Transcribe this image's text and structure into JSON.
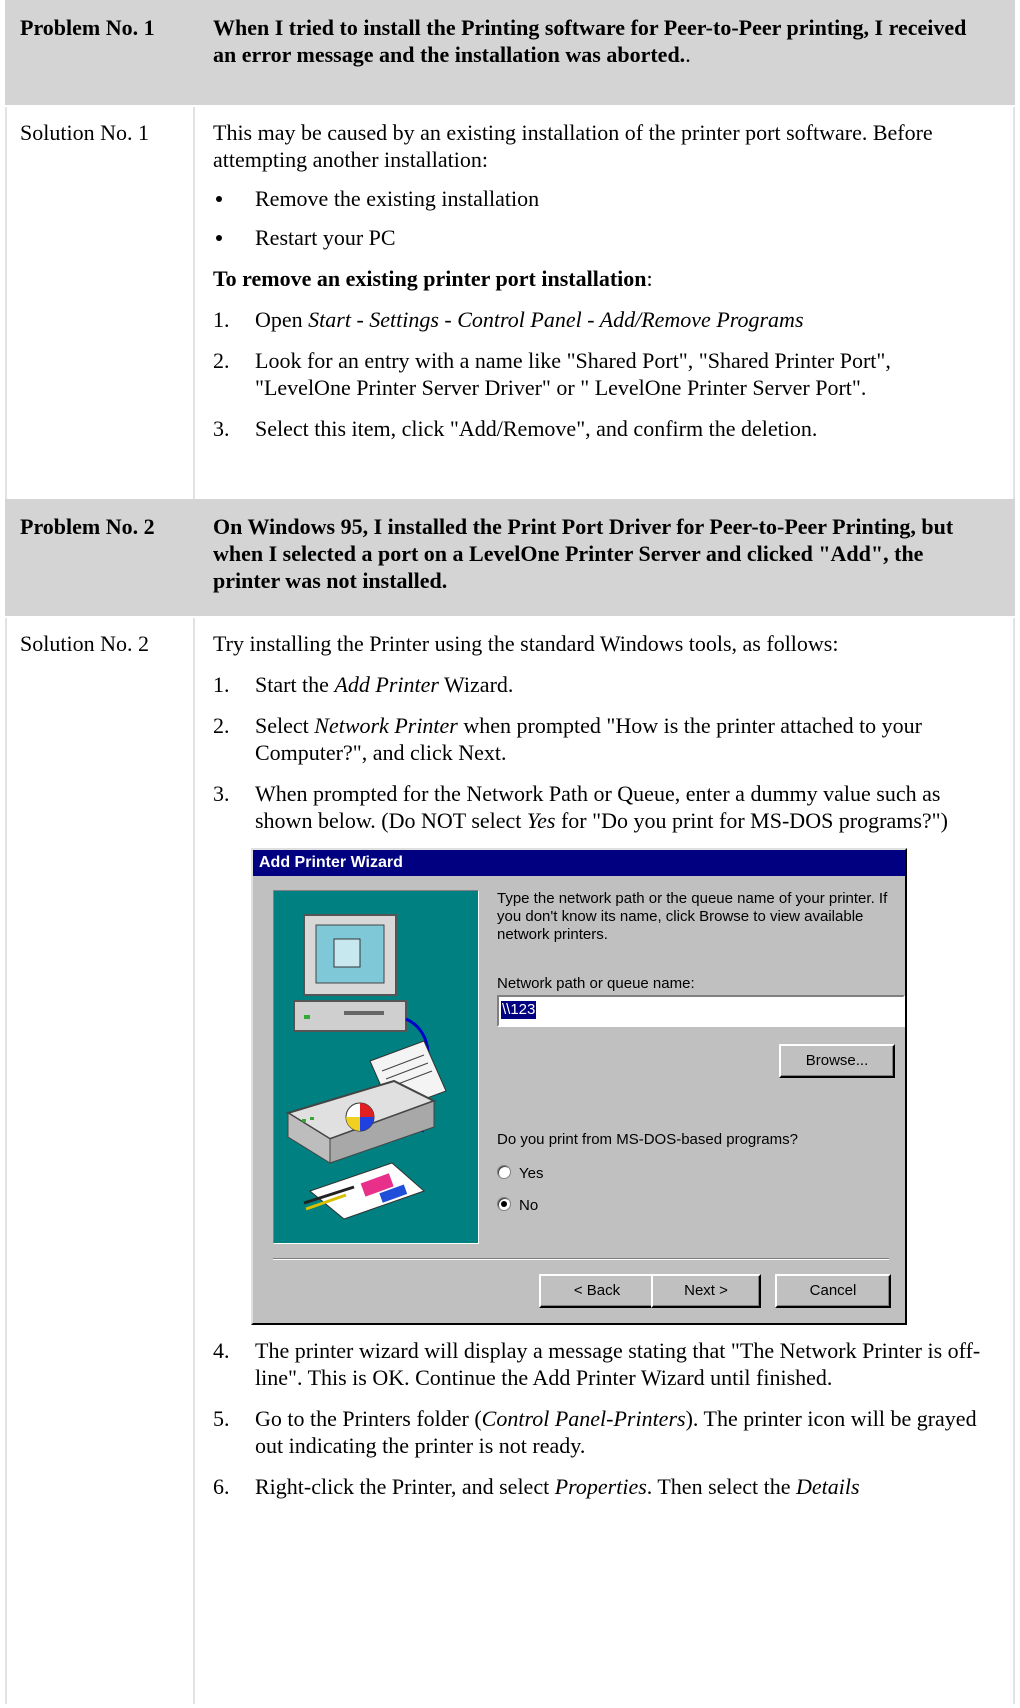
{
  "problem1": {
    "label": "Problem No. 1",
    "text": "When I tried to install the Printing software for Peer-to-Peer printing, I received an error message and the installation was aborted.",
    "text_suffix": "."
  },
  "solution1": {
    "label": "Solution No. 1",
    "intro": "This may be caused by an existing installation of the printer port software. Before attempting another installation:",
    "bullets": [
      "Remove the existing installation",
      "Restart your PC"
    ],
    "heading": "To remove an existing printer port installation",
    "heading_suffix": ":",
    "step1_prefix": "Open ",
    "step1_italic": "Start - Settings - Control Panel - Add/Remove Programs",
    "step2": "Look for an entry with a name like \"Shared Port\", \"Shared Printer Port\", \"LevelOne Printer Server Driver\" or \" LevelOne Printer Server Port\".",
    "step3": "Select this item, click \"Add/Remove\", and confirm the deletion."
  },
  "problem2": {
    "label": "Problem No. 2",
    "text": "On Windows 95, I installed the Print Port Driver for Peer-to-Peer Printing, but when I selected a port on a LevelOne Printer Server and clicked \"Add\", the printer was not installed."
  },
  "solution2": {
    "label": "Solution No. 2",
    "intro": "Try installing the Printer using the standard Windows tools, as follows:",
    "s1_a": "Start the ",
    "s1_i": "Add Printer",
    "s1_b": " Wizard.",
    "s2_a": "Select ",
    "s2_i": "Network Printer",
    "s2_b": " when prompted \"How is the printer attached to your Computer?\", and click Next.",
    "s3_a": "When prompted for the Network Path or Queue, enter a dummy value such as shown below. (Do NOT select ",
    "s3_i": "Yes",
    "s3_b": " for \"Do you print for MS-DOS programs?\")",
    "s4": "The printer wizard will display a message stating that \"The Network Printer is off-line\". This is OK. Continue the Add Printer Wizard until finished.",
    "s5_a": "Go to the Printers folder (",
    "s5_i": "Control Panel-Printers",
    "s5_b": "). The printer icon will be grayed out indicating the printer is not ready.",
    "s6_a": "Right-click the Printer, and select ",
    "s6_i": "Properties",
    "s6_b": ". Then select the ",
    "s6_i2": "Details"
  },
  "numbers": [
    "1.",
    "2.",
    "3.",
    "4.",
    "5.",
    "6."
  ],
  "dialog": {
    "title": "Add Printer Wizard",
    "prompt": "Type the network path or the queue name of your printer. If you don't know its name, click Browse to view available network printers.",
    "field_label": "Network path or queue name:",
    "field_value": "\\\\123",
    "browse": "Browse...",
    "question": "Do you print from MS-DOS-based programs?",
    "yes": "Yes",
    "no": "No",
    "no_selected": true,
    "back": "< Back",
    "next": "Next >",
    "cancel": "Cancel"
  },
  "colors": {
    "header_bg": "#d4d4d4",
    "titlebar": "#000080",
    "wizard_art_bg": "#008080",
    "dialog_face": "#c0c0c0"
  }
}
